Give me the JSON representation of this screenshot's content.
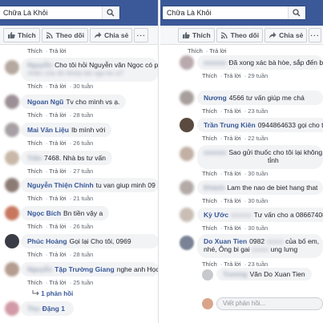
{
  "left_panel": {
    "search_text": "Chữa Là Khỏi",
    "actions": {
      "like": "Thích",
      "follow": "Theo dõi",
      "share": "Chia sẻ",
      "more": "···"
    },
    "comments": [
      {
        "name": "",
        "text": "",
        "meta": {
          "like": "Thích",
          "reply": "Trả lời",
          "time": ""
        }
      },
      {
        "name": "Nguyễn",
        "text": "Cho tôi hỏi Nguyễn văn Ngọc có phải",
        "text2": "nhân của ấn khớp bà ngo ko a?",
        "meta": {
          "like": "Thích",
          "reply": "Trả lời",
          "time": "30 tuần"
        }
      },
      {
        "name": "Ngoan Ngũ",
        "text": "Tv cho mình vs ạ.",
        "meta": {
          "like": "Thích",
          "reply": "Trả lời",
          "time": "28 tuần"
        }
      },
      {
        "name": "Mai Văn Liệu",
        "text": "Ib mình với",
        "meta": {
          "like": "Thích",
          "reply": "Trả lời",
          "time": "26 tuần"
        }
      },
      {
        "name": "Trần",
        "text": "7468. Nhà bs tư vấn",
        "meta": {
          "like": "Thích",
          "reply": "Trả lời",
          "time": "27 tuần"
        }
      },
      {
        "name": "Nguyễn Thiện Chính",
        "text": "tu van giup minh 09",
        "meta": {
          "like": "Thích",
          "reply": "Trả lời",
          "time": "21 tuần"
        }
      },
      {
        "name": "Ngọc Bích",
        "text": "Bn tiền vậy a",
        "meta": {
          "like": "Thích",
          "reply": "Trả lời",
          "time": "26 tuần"
        }
      },
      {
        "name": "Phúc Hoàng",
        "text": "Gọi lại Cho tôi, 0969",
        "meta": {
          "like": "Thích",
          "reply": "Trả lời",
          "time": "28 tuần"
        }
      },
      {
        "name": "Nguyễn",
        "text": "Tập Trường Giang",
        "text3": "nghe anh Học à",
        "meta": {
          "like": "Thích",
          "reply": "Trả lời",
          "time": "25 tuần"
        }
      },
      {
        "name": "Thọ",
        "text": "Đặng 1",
        "meta": {
          "like": "",
          "reply": "",
          "time": ""
        }
      }
    ],
    "reply_count": "1 phản hồi"
  },
  "right_panel": {
    "search_text": "Chữa Là Khỏi",
    "actions": {
      "like": "Thích",
      "follow": "Theo dõi",
      "share": "Chia sẻ",
      "more": "···"
    },
    "comments": [
      {
        "name": "",
        "text": "",
        "meta": {
          "like": "Thích",
          "reply": "Trả lời",
          "time": ""
        }
      },
      {
        "name": "",
        "text": "Đã xong xác bà hòe, sắp đến bà Ng",
        "meta": {
          "like": "Thích",
          "reply": "Trả lời",
          "time": "29 tuần"
        }
      },
      {
        "name": "Nương",
        "text": "4566 tư vấn giúp me chá",
        "meta": {
          "like": "Thích",
          "reply": "Trả lời",
          "time": "23 tuần"
        }
      },
      {
        "name": "Trần Trung Kiên",
        "text": "0944864633 gọi cho tôi",
        "meta": {
          "like": "Thích",
          "reply": "Trả lời",
          "time": "22 tuần"
        }
      },
      {
        "name": "",
        "text": "Sao gửi thuốc cho tôi lại không có qu",
        "text2": "tỉnh",
        "meta": {
          "like": "Thích",
          "reply": "Trả lời",
          "time": "30 tuần"
        }
      },
      {
        "name": "Khánh",
        "text": "Lam the nao de biet hang that",
        "meta": {
          "like": "Thích",
          "reply": "Trả lời",
          "time": "30 tuần"
        }
      },
      {
        "name": "Kỳ Ước",
        "text": "Tư vấn cho a 0866740800",
        "meta": {
          "like": "Thích",
          "reply": "Trả lời",
          "time": "30 tuần"
        }
      },
      {
        "name": "Do Xuan Tien",
        "text": "0982",
        "text2": "của bố em,",
        "text3": "nhé, Ông bi gai",
        "text4": "ung lưng",
        "meta": {
          "like": "Thích",
          "reply": "Trả lời",
          "time": "23 tuần"
        }
      },
      {
        "name": "Trương",
        "text": "Văn Do Xuan Tien",
        "meta": {
          "like": "",
          "reply": "",
          "time": ""
        }
      }
    ],
    "reply_placeholder": "Viết phản hồi..."
  }
}
